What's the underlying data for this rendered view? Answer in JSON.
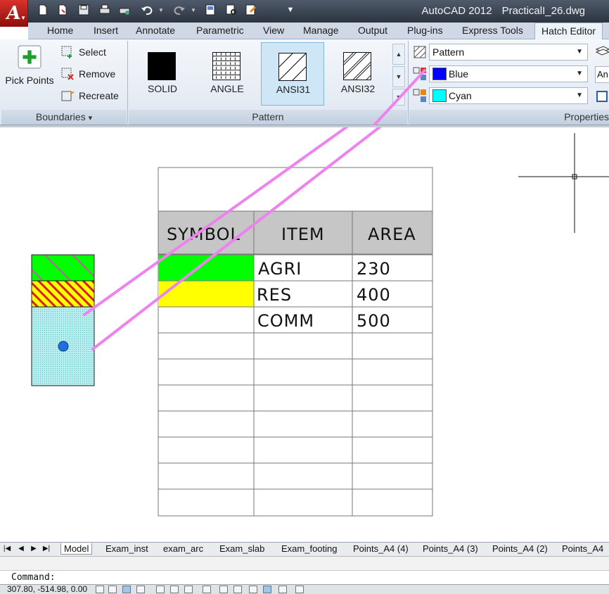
{
  "title_bar": {
    "app_name": "AutoCAD 2012",
    "file_name": "PracticalI_26.dwg"
  },
  "app_menu": {
    "logo_letter": "A"
  },
  "ribbon_tabs": [
    "Home",
    "Insert",
    "Annotate",
    "Parametric",
    "View",
    "Manage",
    "Output",
    "Plug-ins",
    "Express Tools",
    "Hatch Editor"
  ],
  "active_tab": "Hatch Editor",
  "boundaries_panel": {
    "pick_points": "Pick Points",
    "select": "Select",
    "remove": "Remove",
    "recreate": "Recreate",
    "footer": "Boundaries",
    "footer_arrow": "▾"
  },
  "pattern_panel": {
    "swatches": [
      "SOLID",
      "ANGLE",
      "ANSI31",
      "ANSI32"
    ],
    "selected": "ANSI31",
    "footer": "Pattern"
  },
  "properties_panel": {
    "hatch_type": "Pattern",
    "hatch_color": "Blue",
    "hatch_color_hex": "#0000ff",
    "background_color": "Cyan",
    "background_color_hex": "#00ffff",
    "partial_field": "An",
    "footer": "Properties"
  },
  "drawing": {
    "table": {
      "headers": [
        "SYMBOL",
        "ITEM",
        "AREA"
      ],
      "rows": [
        {
          "item": "AGRI",
          "area": "230",
          "symbol_color": "#00ff00"
        },
        {
          "item": "RES",
          "area": "400",
          "symbol_color": "#ffff00"
        },
        {
          "item": "COMM",
          "area": "500",
          "symbol_color": ""
        }
      ]
    },
    "colors": {
      "agri": "#00ff00",
      "res_fill": "#ffff00",
      "res_hatch": "#d62020",
      "comm": "#b6eef0",
      "leader": "#ee82ee",
      "grip": "#1e6fe0"
    }
  },
  "layout_tabs": [
    "Model",
    "Exam_inst",
    "exam_arc",
    "Exam_slab",
    "Exam_footing",
    "Points_A4 (4)",
    "Points_A4 (3)",
    "Points_A4 (2)",
    "Points_A4"
  ],
  "active_layout": "Model",
  "command": {
    "prompt": "Command:"
  },
  "status_bar": {
    "coordinates": "307.80, -514.98, 0.00"
  }
}
